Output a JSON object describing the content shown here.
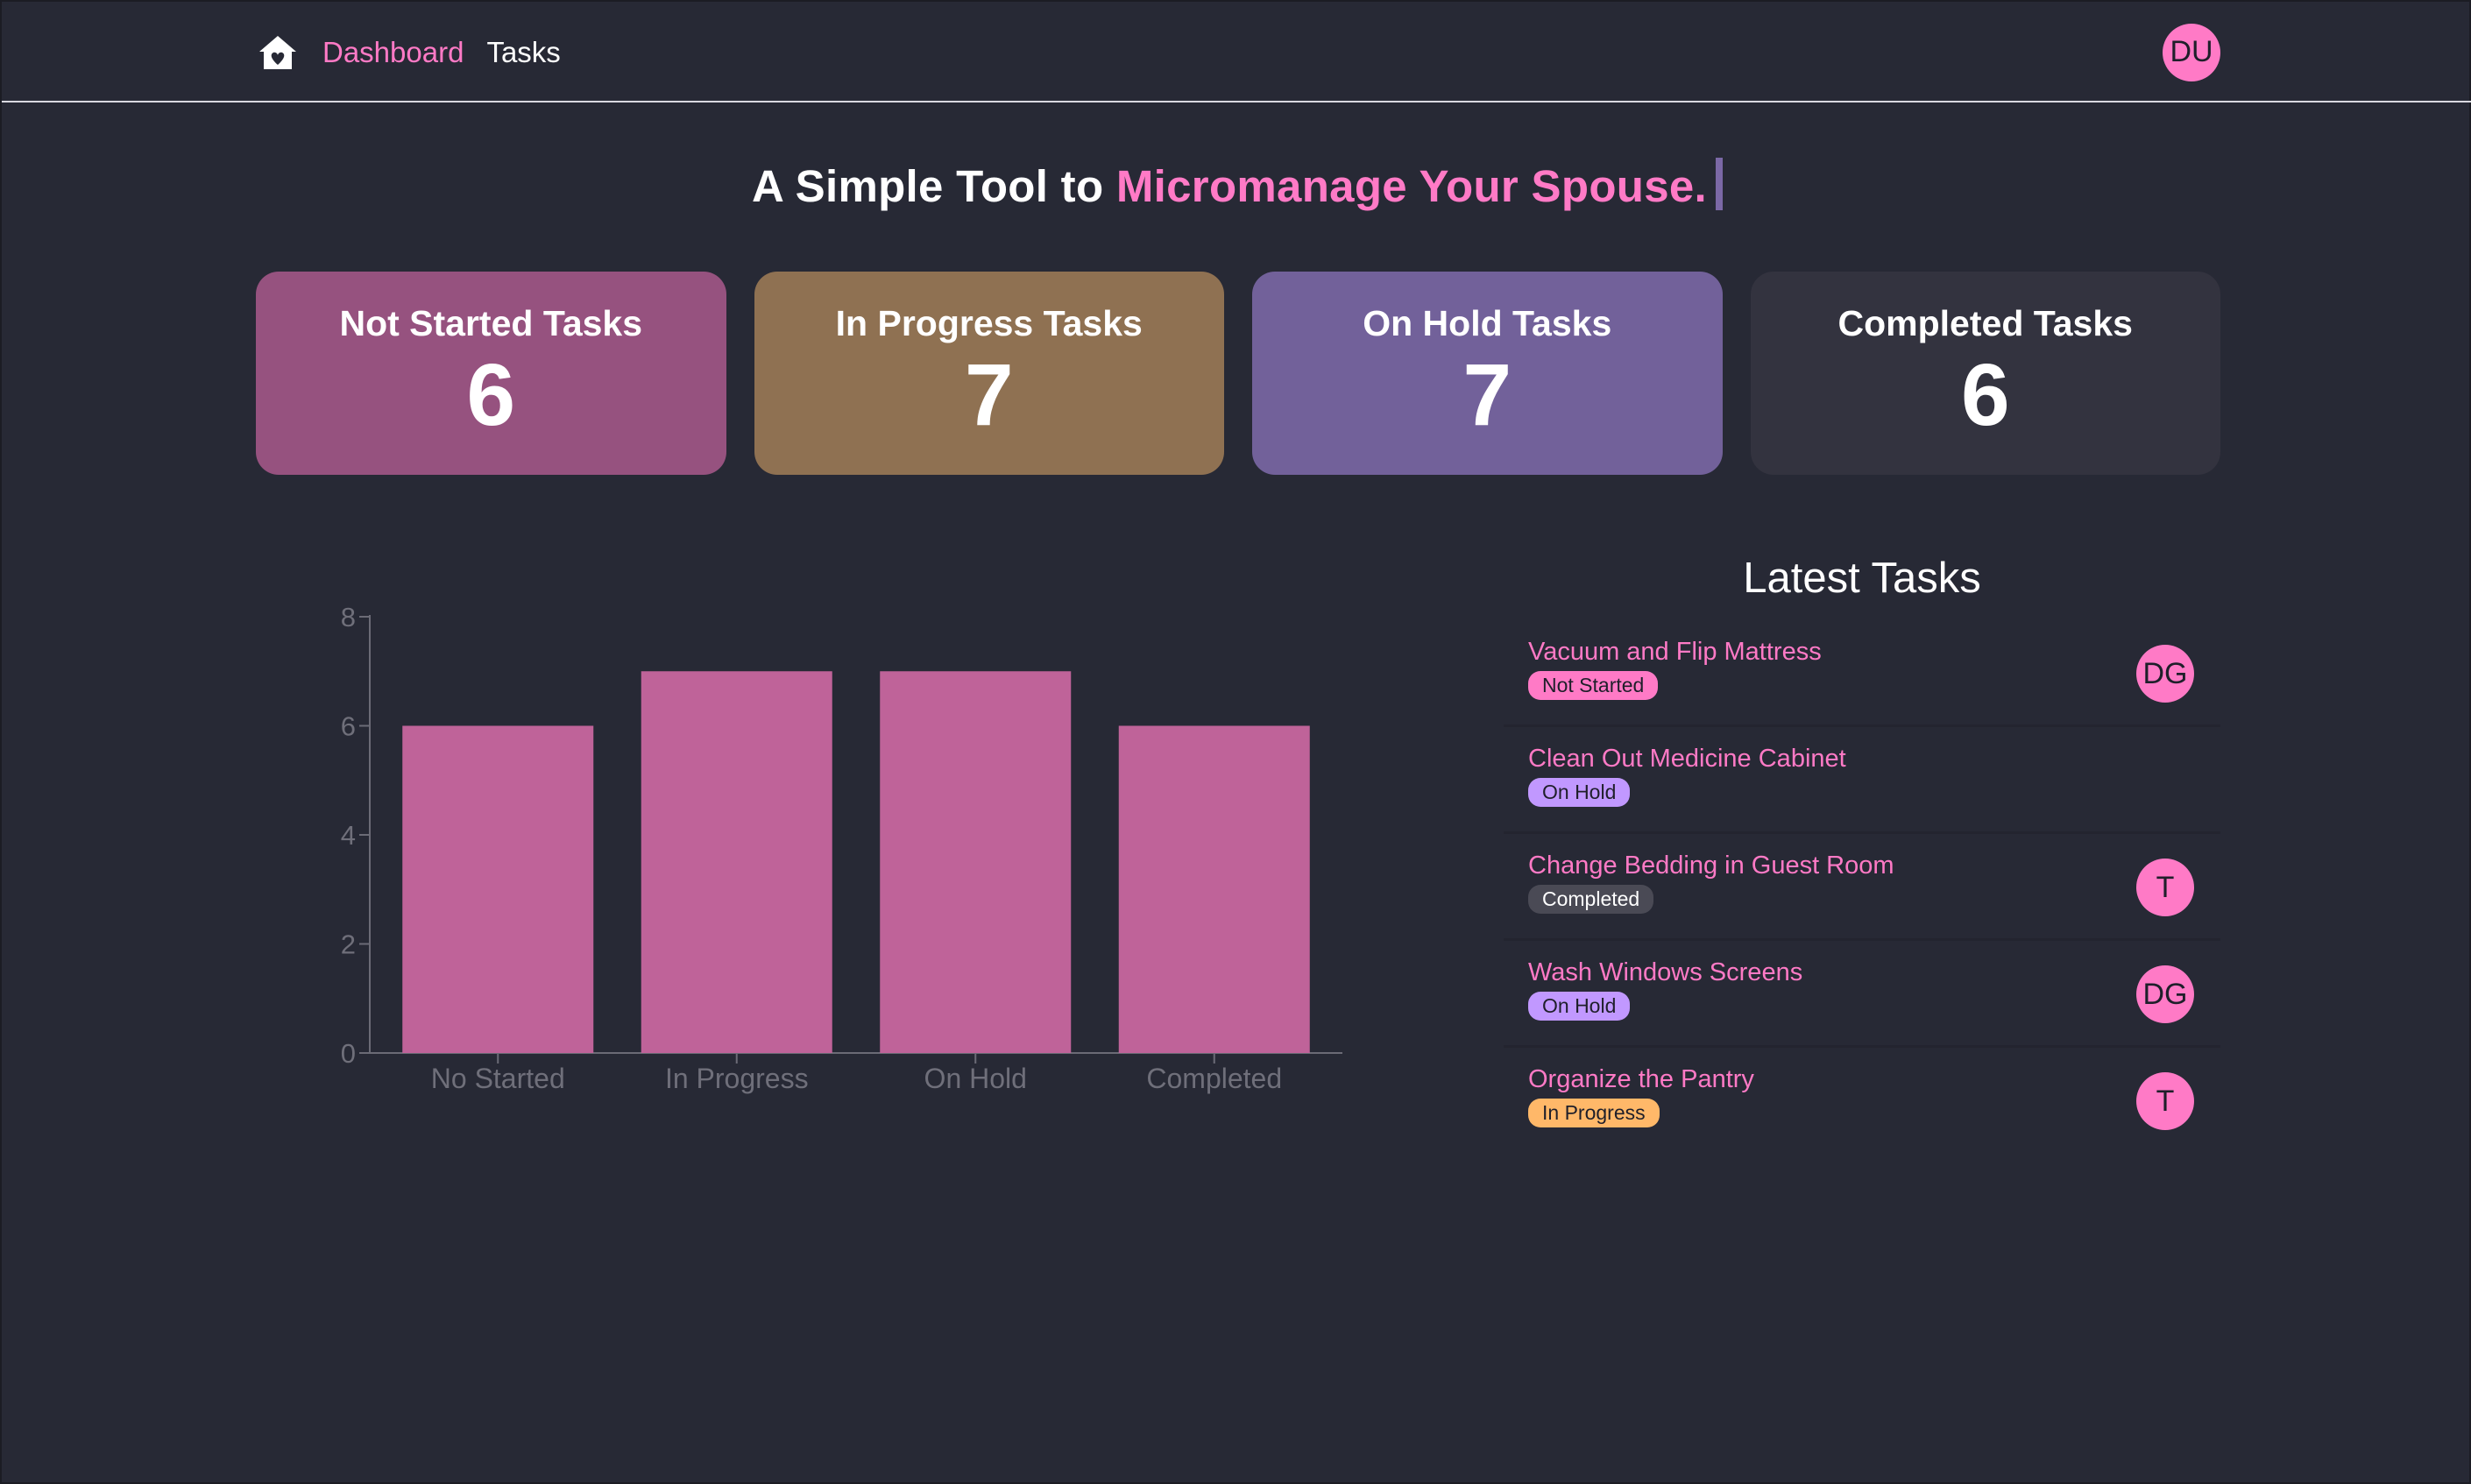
{
  "nav": {
    "links": [
      {
        "label": "Dashboard",
        "active": true
      },
      {
        "label": "Tasks",
        "active": false
      }
    ],
    "user_initials": "DU"
  },
  "headline": {
    "prefix": "A Simple Tool to ",
    "accent": "Micromanage Your Spouse."
  },
  "stats": [
    {
      "title": "Not Started Tasks",
      "value": "6"
    },
    {
      "title": "In Progress Tasks",
      "value": "7"
    },
    {
      "title": "On Hold Tasks",
      "value": "7"
    },
    {
      "title": "Completed Tasks",
      "value": "6"
    }
  ],
  "colors": {
    "accent": "#ff7ac6",
    "bar": "#bf6399",
    "background": "#272935"
  },
  "chart_data": {
    "type": "bar",
    "categories": [
      "No Started",
      "In Progress",
      "On Hold",
      "Completed"
    ],
    "values": [
      6,
      7,
      7,
      6
    ],
    "ylim": [
      0,
      8
    ],
    "yticks": [
      0,
      2,
      4,
      6,
      8
    ],
    "grid": false
  },
  "latest": {
    "title": "Latest Tasks",
    "tasks": [
      {
        "name": "Vacuum and Flip Mattress",
        "status": "Not Started",
        "status_key": "notstarted",
        "assignee": "DG"
      },
      {
        "name": "Clean Out Medicine Cabinet",
        "status": "On Hold",
        "status_key": "onhold",
        "assignee": ""
      },
      {
        "name": "Change Bedding in Guest Room",
        "status": "Completed",
        "status_key": "completed",
        "assignee": "T"
      },
      {
        "name": "Wash Windows Screens",
        "status": "On Hold",
        "status_key": "onhold",
        "assignee": "DG"
      },
      {
        "name": "Organize the Pantry",
        "status": "In Progress",
        "status_key": "inprogress",
        "assignee": "T"
      }
    ]
  }
}
